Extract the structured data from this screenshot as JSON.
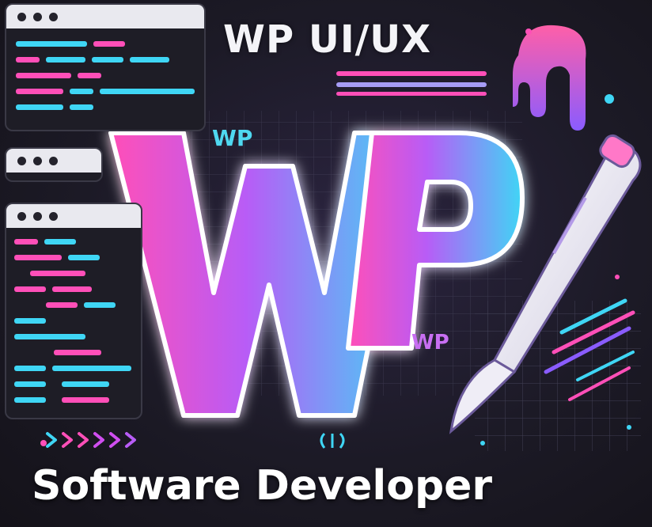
{
  "headline": "WP UI/UX",
  "logo_text": "WP",
  "badge_top": "WP",
  "badge_mid": "WP",
  "footer_title": "Software Developer",
  "colors": {
    "pink": "#ff4fb8",
    "magenta": "#d04ef0",
    "cyan": "#3fd6f5",
    "violet": "#8a5cff",
    "background": "#1c1a26"
  },
  "icons": [
    "code-window-icon",
    "paintbrush-icon",
    "grid-pattern-icon",
    "chevrons-icon",
    "code-braces-icon"
  ]
}
